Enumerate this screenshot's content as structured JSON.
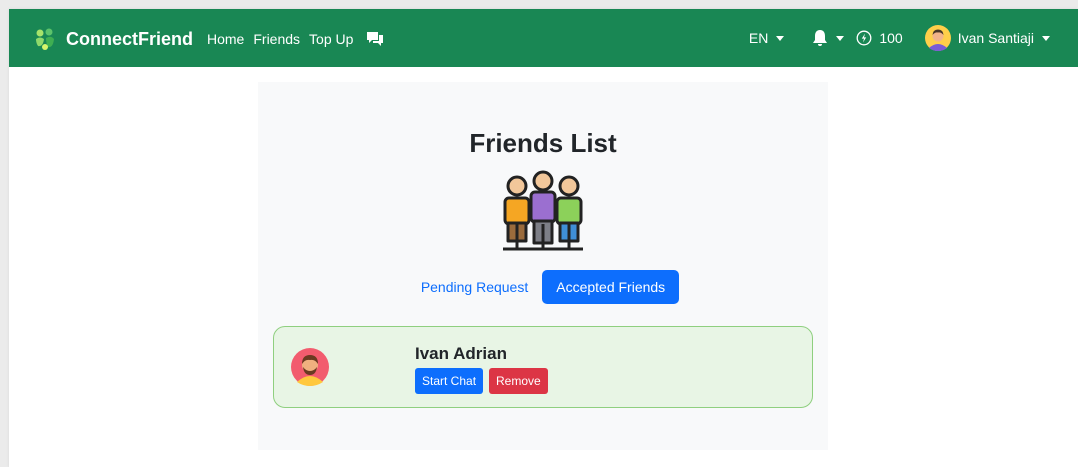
{
  "navbar": {
    "brand": "ConnectFriend",
    "links": [
      "Home",
      "Friends",
      "Top Up"
    ],
    "language": "EN",
    "coins": "100",
    "user_name": "Ivan Santiaji",
    "icons": {
      "brand": "leaf-icon",
      "chat": "chat-bubbles-icon",
      "notifications": "bell-icon",
      "coins": "coin-icon"
    }
  },
  "main": {
    "title": "Friends List",
    "tabs": {
      "pending": "Pending Request",
      "accepted": "Accepted Friends"
    },
    "friends": [
      {
        "name": "Ivan Adrian",
        "chat_label": "Start Chat",
        "remove_label": "Remove"
      }
    ]
  },
  "colors": {
    "navbar": "#198754",
    "primary": "#0d6efd",
    "danger": "#dc3545",
    "friend_card_bg": "#e8f5e5",
    "friend_card_border": "#8fcf7f"
  }
}
